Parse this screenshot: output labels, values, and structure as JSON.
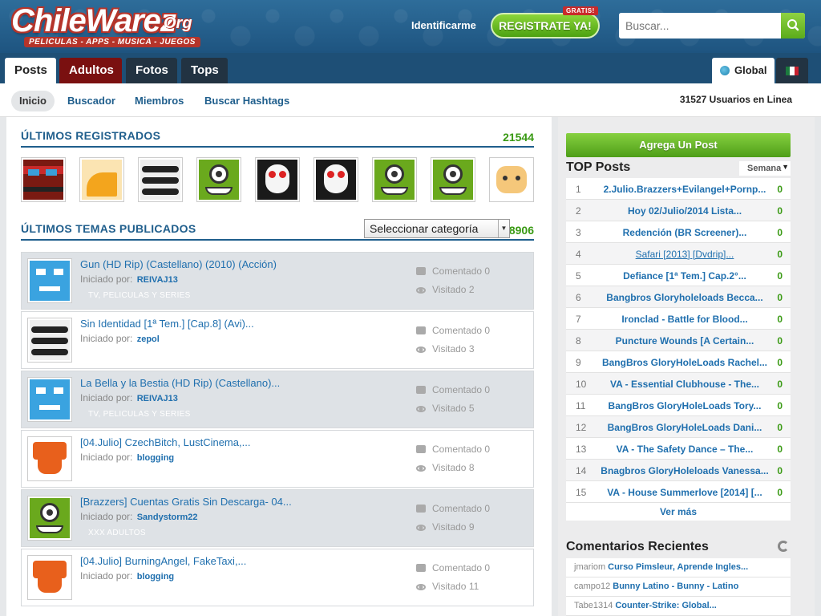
{
  "header": {
    "logo_word": "ChileWarez",
    "logo_suffix": "Org",
    "logo_tagline": "PELICULAS - APPS - MUSICA - JUEGOS",
    "login_label": "Identificarme",
    "register_label": "REGISTRATE YA!",
    "register_badge": "GRATIS!",
    "search_placeholder": "Buscar..."
  },
  "tabs": {
    "posts": "Posts",
    "adultos": "Adultos",
    "fotos": "Fotos",
    "tops": "Tops",
    "global": "Global"
  },
  "subnav": {
    "inicio": "Inicio",
    "buscador": "Buscador",
    "miembros": "Miembros",
    "hashtags": "Buscar Hashtags",
    "online": "31527 Usuarios en Linea"
  },
  "registered": {
    "title": "ÚLTIMOS REGISTRADOS",
    "count": "21544"
  },
  "topics": {
    "title": "ÚLTIMOS TEMAS PUBLICADOS",
    "count": "18906",
    "category_select": "Seleccionar categoría",
    "by_label": "Iniciado por:",
    "commented_label": "Comentado",
    "visited_label": "Visitado",
    "items": [
      {
        "title": "Gun (HD Rip) (Castellano) (2010) (Acción)",
        "author": "REIVAJ13",
        "category": "TV, PELICULAS Y SERIES",
        "comments": "0",
        "visits": "2"
      },
      {
        "title": "Sin Identidad [1ª Tem.] [Cap.8] (Avi)...",
        "author": "zepol",
        "category": "",
        "comments": "0",
        "visits": "3"
      },
      {
        "title": "La Bella y la Bestia (HD Rip) (Castellano)...",
        "author": "REIVAJ13",
        "category": "TV, PELICULAS Y SERIES",
        "comments": "0",
        "visits": "5"
      },
      {
        "title": "[04.Julio] CzechBitch, LustCinema,...",
        "author": "blogging",
        "category": "",
        "comments": "0",
        "visits": "8"
      },
      {
        "title": "[Brazzers] Cuentas Gratis Sin Descarga- 04...",
        "author": "Sandystorm22",
        "category": "XXX ADULTOS",
        "comments": "0",
        "visits": "9"
      },
      {
        "title": "[04.Julio] BurningAngel, FakeTaxi,...",
        "author": "blogging",
        "category": "",
        "comments": "0",
        "visits": "11"
      }
    ]
  },
  "sidebar": {
    "add_post": "Agrega Un Post",
    "top_title": "TOP Posts",
    "period": "Semana",
    "top_posts": [
      {
        "n": "1",
        "title": "2.Julio.Brazzers+Evilangel+Pornp...",
        "v": "0"
      },
      {
        "n": "2",
        "title": "Hoy 02/Julio/2014 Lista...",
        "v": "0"
      },
      {
        "n": "3",
        "title": "Redención (BR Screener)...",
        "v": "0"
      },
      {
        "n": "4",
        "title": "Safari [2013] [Dvdrip]...",
        "v": "0"
      },
      {
        "n": "5",
        "title": "Defiance [1ª Tem.] Cap.2°...",
        "v": "0"
      },
      {
        "n": "6",
        "title": "Bangbros Gloryholeloads Becca...",
        "v": "0"
      },
      {
        "n": "7",
        "title": "Ironclad - Battle for Blood...",
        "v": "0"
      },
      {
        "n": "8",
        "title": "Puncture Wounds [A Certain...",
        "v": "0"
      },
      {
        "n": "9",
        "title": "BangBros GloryHoleLoads Rachel...",
        "v": "0"
      },
      {
        "n": "10",
        "title": "VA - Essential Clubhouse - The...",
        "v": "0"
      },
      {
        "n": "11",
        "title": "BangBros GloryHoleLoads Tory...",
        "v": "0"
      },
      {
        "n": "12",
        "title": "BangBros GloryHoleLoads Dani...",
        "v": "0"
      },
      {
        "n": "13",
        "title": "VA - The Safety Dance – The...",
        "v": "0"
      },
      {
        "n": "14",
        "title": "Bnagbros GloryHoleloads Vanessa...",
        "v": "0"
      },
      {
        "n": "15",
        "title": "VA - House Summerlove [2014] [...",
        "v": "0"
      }
    ],
    "more": "Ver más",
    "comments_title": "Comentarios Recientes",
    "comments": [
      {
        "user": "jmariom",
        "post": "Curso Pimsleur, Aprende Ingles..."
      },
      {
        "user": "campo12",
        "post": "Bunny Latino - Bunny - Latino"
      },
      {
        "user": "Tabe1314",
        "post": "Counter-Strike: Global..."
      }
    ]
  },
  "colors": {
    "link": "#1f6fae",
    "count_green": "#3a9a14",
    "header_blue": "#1e5480",
    "adult_red": "#7a1010"
  }
}
